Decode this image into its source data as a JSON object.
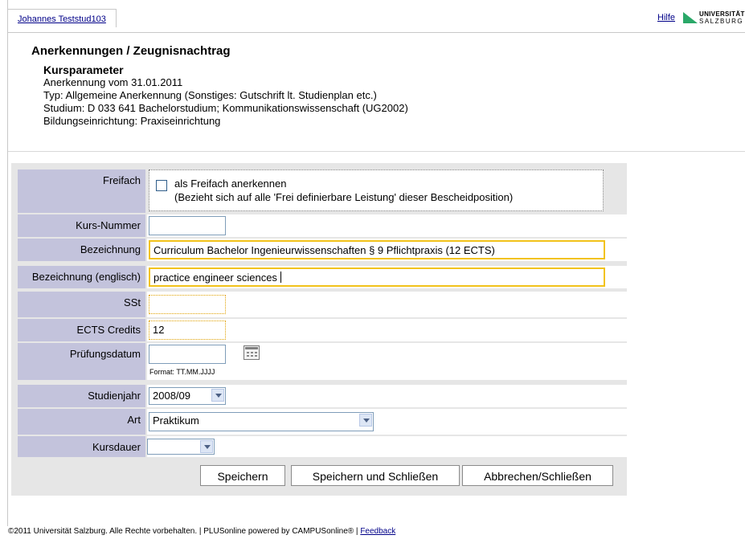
{
  "topbar": {
    "user_tab": "Johannes Teststud103",
    "help_link": "Hilfe",
    "logo_line1": "UNIVERSITÄT",
    "logo_line2": "SALZBURG"
  },
  "header": {
    "title": "Anerkennungen / Zeugnisnachtrag",
    "section": "Kursparameter",
    "lines": [
      "Anerkennung vom 31.01.2011",
      "Typ: Allgemeine Anerkennung (Sonstiges: Gutschrift lt. Studienplan etc.)",
      "Studium: D 033 641 Bachelorstudium; Kommunikationswissenschaft (UG2002)",
      "Bildungseinrichtung: Praxiseinrichtung"
    ]
  },
  "form": {
    "freifach": {
      "label": "Freifach",
      "checkbox_label": "als Freifach anerkennen",
      "note": "(Bezieht sich auf alle 'Frei definierbare Leistung' dieser Bescheidposition)",
      "checked": false
    },
    "kursnummer": {
      "label": "Kurs-Nummer",
      "value": ""
    },
    "bezeichnung": {
      "label": "Bezeichnung",
      "value": "Curriculum Bachelor Ingenieurwissenschaften § 9 Pflichtpraxis (12 ECTS)"
    },
    "bezeichnung_en": {
      "label": "Bezeichnung (englisch)",
      "value": "practice engineer sciences"
    },
    "sst": {
      "label": "SSt",
      "value": ""
    },
    "ects": {
      "label": "ECTS Credits",
      "value": "12"
    },
    "pruefungsdatum": {
      "label": "Prüfungsdatum",
      "value": "",
      "format_hint": "Format: TT.MM.JJJJ"
    },
    "studienjahr": {
      "label": "Studienjahr",
      "value": "2008/09"
    },
    "art": {
      "label": "Art",
      "value": "Praktikum"
    },
    "kursdauer": {
      "label": "Kursdauer",
      "value": ""
    }
  },
  "buttons": {
    "save": "Speichern",
    "save_close": "Speichern und Schließen",
    "cancel": "Abbrechen/Schließen"
  },
  "footer": {
    "text": "©2011 Universität Salzburg. Alle Rechte vorbehalten. | PLUSonline powered by CAMPUSonline® | ",
    "feedback": "Feedback"
  },
  "colors": {
    "label_bg": "#c3c3dc",
    "form_bg": "#e6e6e6",
    "highlight": "#f2c21a",
    "link": "#000088",
    "logo_green": "#2aa868"
  }
}
